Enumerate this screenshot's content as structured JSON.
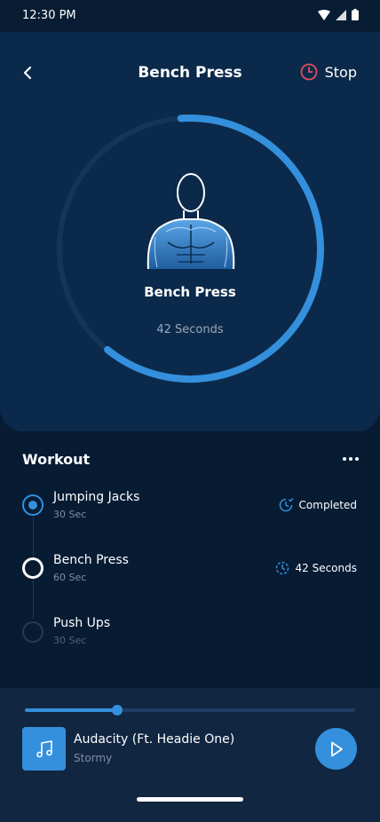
{
  "status_bar": {
    "time": "12:30 PM"
  },
  "header": {
    "title": "Bench Press",
    "stop_label": "Stop"
  },
  "current_exercise": {
    "name": "Bench Press",
    "time_label": "42 Seconds",
    "ring_progress": 0.62
  },
  "workout": {
    "title": "Workout",
    "items": [
      {
        "name": "Jumping Jacks",
        "duration": "30 Sec",
        "status": "Completed"
      },
      {
        "name": "Bench Press",
        "duration": "60 Sec",
        "status": "42 Seconds"
      },
      {
        "name": "Push Ups",
        "duration": "30 Sec",
        "status": ""
      }
    ]
  },
  "player": {
    "song_title": "Audacity (Ft. Headie One)",
    "artist": "Stormy",
    "progress": 0.28
  },
  "colors": {
    "background": "#071b33",
    "card": "#0b2a4b",
    "accent": "#3490dc",
    "stop_icon": "#e0505d"
  }
}
